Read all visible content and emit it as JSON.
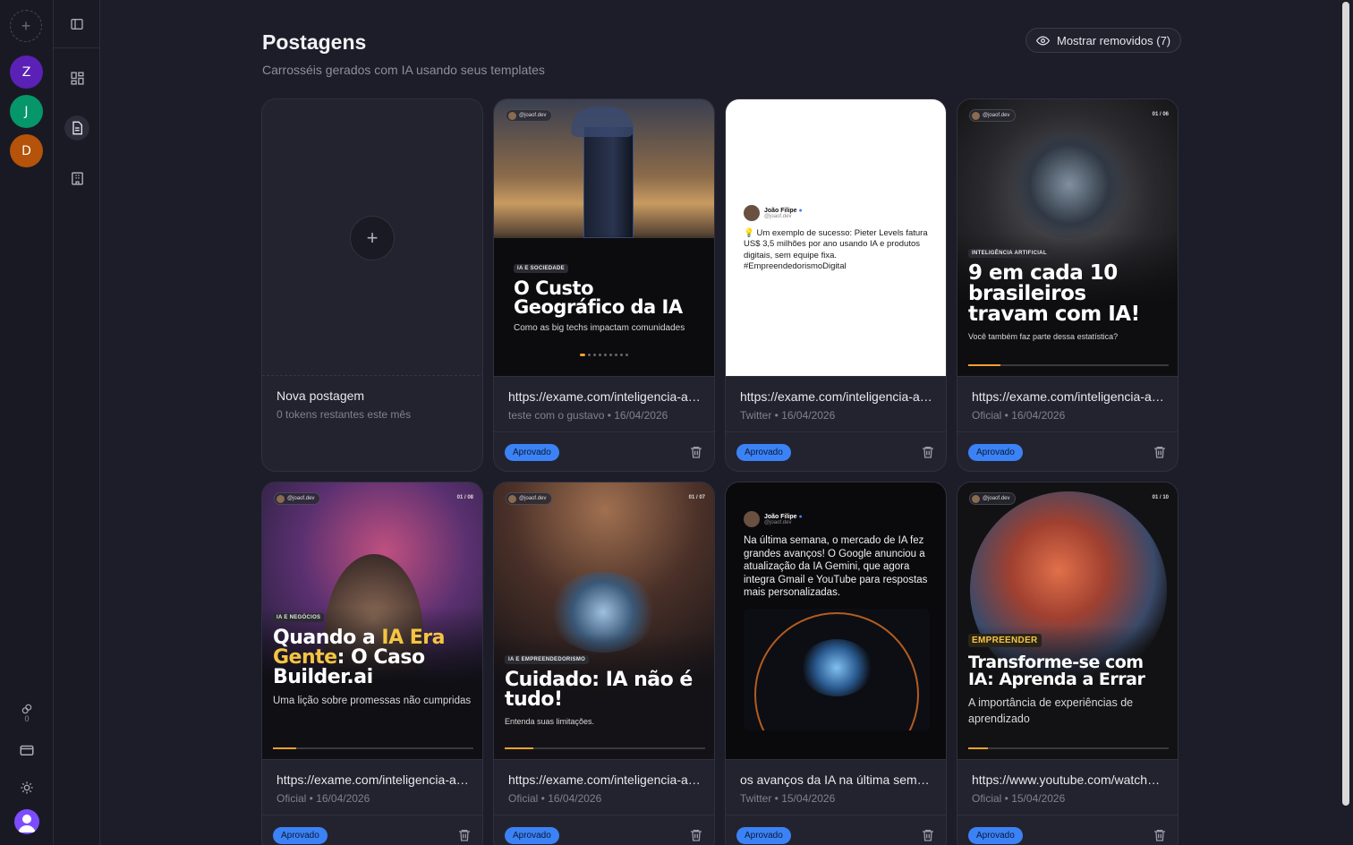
{
  "rail": {
    "workspaces": [
      {
        "letter": "Z",
        "color": "#5b21b6"
      },
      {
        "letter": "J",
        "color": "#059669"
      },
      {
        "letter": "D",
        "color": "#b45309"
      }
    ],
    "token_count": "0"
  },
  "page": {
    "title": "Postagens",
    "subtitle": "Carrosséis gerados com IA usando seus templates",
    "show_removed": "Mostrar removidos (7)"
  },
  "new_post": {
    "title": "Nova postagem",
    "subtitle": "0 tokens restantes este mês"
  },
  "cards": [
    {
      "title": "https://exame.com/inteligencia-artificial/",
      "subtitle": "teste com o gustavo • 16/04/2026",
      "status": "Aprovado",
      "slide": {
        "handle": "@joaof.dev",
        "tag": "IA E SOCIEDADE",
        "headline": "O Custo Geográfico da IA",
        "body": "Como as big techs impactam comunidades"
      }
    },
    {
      "title": "https://exame.com/inteligencia-artificial/",
      "subtitle": "Twitter • 16/04/2026",
      "status": "Aprovado",
      "slide": {
        "name": "João Filipe",
        "handle": "@joaof.dev",
        "body": "💡 Um exemplo de sucesso: Pieter Levels fatura US$ 3,5 milhões por ano usando IA e produtos digitais, sem equipe fixa. #EmpreendedorismoDigital"
      }
    },
    {
      "title": "https://exame.com/inteligencia-artificial/",
      "subtitle": "Oficial • 16/04/2026",
      "status": "Aprovado",
      "slide": {
        "handle": "@joaof.dev",
        "pager": "01 / 06",
        "tag": "INTELIGÊNCIA ARTIFICIAL",
        "headline": "9 em cada 10 brasileiros travam com IA!",
        "body": "Você também faz parte dessa estatística?"
      }
    },
    {
      "title": "https://exame.com/inteligencia-artificial/",
      "subtitle": "Oficial • 16/04/2026",
      "status": "Aprovado",
      "slide": {
        "handle": "@joaof.dev",
        "pager": "01 / 08",
        "tag": "IA E NEGÓCIOS",
        "headline_a": "Quando a ",
        "headline_b": "IA Era Gente",
        "headline_c": ": O Caso Builder.ai",
        "body": "Uma lição sobre promessas não cumpridas"
      }
    },
    {
      "title": "https://exame.com/inteligencia-artificial/",
      "subtitle": "Oficial • 16/04/2026",
      "status": "Aprovado",
      "slide": {
        "handle": "@joaof.dev",
        "pager": "01 / 07",
        "tag": "IA E EMPREENDEDORISMO",
        "headline": "Cuidado: IA não é tudo!",
        "body": "Entenda suas limitações."
      }
    },
    {
      "title": "os avanços da IA na última semana",
      "subtitle": "Twitter • 15/04/2026",
      "status": "Aprovado",
      "slide": {
        "name": "João Filipe",
        "handle": "@joaof.dev",
        "body": "Na última semana, o mercado de IA fez grandes avanços! O Google anunciou a atualização da IA Gemini, que agora integra Gmail e YouTube para respostas mais personalizadas."
      }
    },
    {
      "title": "https://www.youtube.com/watch?v=",
      "subtitle": "Oficial • 15/04/2026",
      "status": "Aprovado",
      "slide": {
        "handle": "@joaof.dev",
        "pager": "01 / 10",
        "tag": "EMPREENDER",
        "headline": "Transforme-se com IA: Aprenda a Errar",
        "body": "A importância de experiências de aprendizado"
      }
    }
  ]
}
